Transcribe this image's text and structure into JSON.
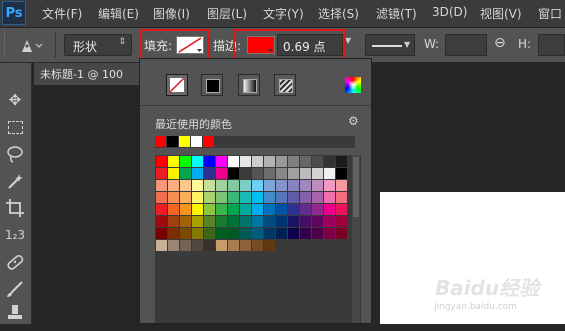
{
  "app": {
    "logo": "Ps"
  },
  "menu": [
    "文件(F)",
    "编辑(E)",
    "图像(I)",
    "图层(L)",
    "文字(Y)",
    "选择(S)",
    "滤镜(T)",
    "3D(D)",
    "视图(V)",
    "窗口"
  ],
  "options": {
    "tool_icon": "pen-icon",
    "mode_value": "形状",
    "fill_label": "填充:",
    "stroke_label": "描边:",
    "stroke_color": "#ff0000",
    "stroke_width": "0.69 点",
    "width_label": "W:",
    "height_label": "H:"
  },
  "document_tab": {
    "title": "未标题-1 @ 100"
  },
  "popup": {
    "recent_label": "最近使用的颜色",
    "recent_colors": [
      "#ff0000",
      "#000000",
      "#ffff00",
      "#ffffff",
      "#ff0000"
    ],
    "fill_types": [
      "no-color-icon",
      "solid-color-icon",
      "gradient-icon",
      "pattern-icon"
    ],
    "picker_icon": "color-picker-icon",
    "gear_icon": "gear-icon",
    "swatches": [
      [
        "#ff0000",
        "#ffff00",
        "#00ff00",
        "#00ffff",
        "#0000ff",
        "#ff00ff",
        "#ffffff",
        "#e6e6e6",
        "#cccccc",
        "#b3b3b3",
        "#999999",
        "#808080",
        "#666666",
        "#4d4d4d",
        "#333333",
        "#1a1a1a"
      ],
      [
        "#ed1c24",
        "#fff200",
        "#00a651",
        "#00aeef",
        "#2e3192",
        "#ec008c",
        "#000000",
        "#3b3b3b",
        "#555555",
        "#6d6d6d",
        "#888888",
        "#a0a0a0",
        "#bcbcbc",
        "#d4d4d4",
        "#f0f0f0",
        "#000000"
      ],
      [
        "#f7977a",
        "#f9ad81",
        "#fdc68a",
        "#fff79a",
        "#c4df9b",
        "#a3d39c",
        "#82ca9d",
        "#7bcdc8",
        "#6ecff6",
        "#7ea7d8",
        "#8493ca",
        "#8882be",
        "#a187be",
        "#bc8dbf",
        "#f49ac2",
        "#f6989d"
      ],
      [
        "#f26c4f",
        "#f68e55",
        "#fbaf5c",
        "#fff467",
        "#acd372",
        "#7cc576",
        "#3bb878",
        "#1abbb4",
        "#00bff3",
        "#438ccb",
        "#5574b9",
        "#605ca8",
        "#855fa8",
        "#a763a8",
        "#f06ea9",
        "#f26d7d"
      ],
      [
        "#ed1c24",
        "#f26522",
        "#f7941d",
        "#fff200",
        "#8dc73f",
        "#39b54a",
        "#00a651",
        "#00a99d",
        "#00aeef",
        "#0072bc",
        "#0054a6",
        "#2e3192",
        "#662d91",
        "#92278f",
        "#ec008c",
        "#ed145b"
      ],
      [
        "#9e0b0f",
        "#a0410d",
        "#a36209",
        "#aba000",
        "#598527",
        "#1a7b30",
        "#007236",
        "#00746b",
        "#0076a3",
        "#004b80",
        "#003471",
        "#1b1464",
        "#440e62",
        "#630460",
        "#9e005d",
        "#9e0039"
      ],
      [
        "#790000",
        "#7b2e00",
        "#7d4900",
        "#827b00",
        "#406618",
        "#005e20",
        "#005826",
        "#005952",
        "#005b7f",
        "#003663",
        "#002157",
        "#0d004c",
        "#32004b",
        "#4b0049",
        "#7b0046",
        "#7a0026"
      ],
      [
        "#c7b299",
        "#998675",
        "#736357",
        "#534741",
        "#37302d",
        "#c69c6d",
        "#a67c52",
        "#8c6239",
        "#754c24",
        "#603913"
      ]
    ]
  },
  "watermark": {
    "line1": "Baidu经验",
    "line2": "jingyan.baidu.com"
  }
}
